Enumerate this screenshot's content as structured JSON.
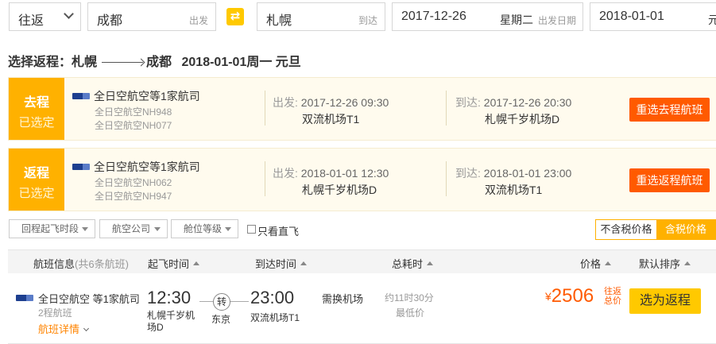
{
  "search": {
    "trip_type": "往返",
    "from": "成都",
    "from_hint": "出发",
    "to": "札幌",
    "to_hint": "到达",
    "depart_date": "2017-12-26",
    "depart_weekday": "星期二",
    "depart_hint": "出发日期",
    "return_date": "2018-01-01",
    "return_cut": "元",
    "swap_icon": "⇄"
  },
  "heading": {
    "prefix": "选择返程：",
    "from": "札幌",
    "to": "成都",
    "date": "2018-01-01周一 元旦"
  },
  "legs": [
    {
      "badge_top": "去程",
      "badge_bottom": "已选定",
      "airline": "全日空航空等1家航司",
      "flights": [
        "全日空航空NH948",
        "全日空航空NH077"
      ],
      "depart_key": "出发:",
      "depart_time": "2017-12-26 09:30",
      "depart_port": "双流机场T1",
      "arrive_key": "到达:",
      "arrive_time": "2017-12-26 20:30",
      "arrive_port": "札幌千岁机场D",
      "button": "重选去程航班"
    },
    {
      "badge_top": "返程",
      "badge_bottom": "已选定",
      "airline": "全日空航空等1家航司",
      "flights": [
        "全日空航空NH062",
        "全日空航空NH947"
      ],
      "depart_key": "出发:",
      "depart_time": "2018-01-01 12:30",
      "depart_port": "札幌千岁机场D",
      "arrive_key": "到达:",
      "arrive_time": "2018-01-01 23:00",
      "arrive_port": "双流机场T1",
      "button": "重选返程航班"
    }
  ],
  "filters": {
    "time": "回程起飞时段",
    "airline": "航空公司",
    "cabin": "舱位等级",
    "direct": "只看直飞",
    "tax_excl": "不含税价格",
    "tax_incl": "含税价格"
  },
  "table_head": {
    "flight_info": "航班信息",
    "flight_count": "(共6条航班)",
    "depart": "起飞时间",
    "arrive": "到达时间",
    "duration": "总耗时",
    "price": "价格",
    "sort": "默认排序"
  },
  "flight_row": {
    "airline": "全日空航空 等1家航司",
    "segments": "2程航班",
    "detail": "航班详情",
    "depart_time": "12:30",
    "depart_port": "札幌千岁机场D",
    "transfer_mark": "转",
    "transfer_city": "东京",
    "arrive_time": "23:00",
    "arrive_port": "双流机场T1",
    "change_note": "需换机场",
    "duration": "约11时30分",
    "lowest": "最低价",
    "currency": "¥",
    "price": "2506",
    "round_trip_note": "往返总价",
    "select": "选为返程"
  },
  "colors": {
    "accent_orange": "#ff5a00",
    "badge_yellow": "#ffb100",
    "button_yellow": "#ffc900"
  }
}
